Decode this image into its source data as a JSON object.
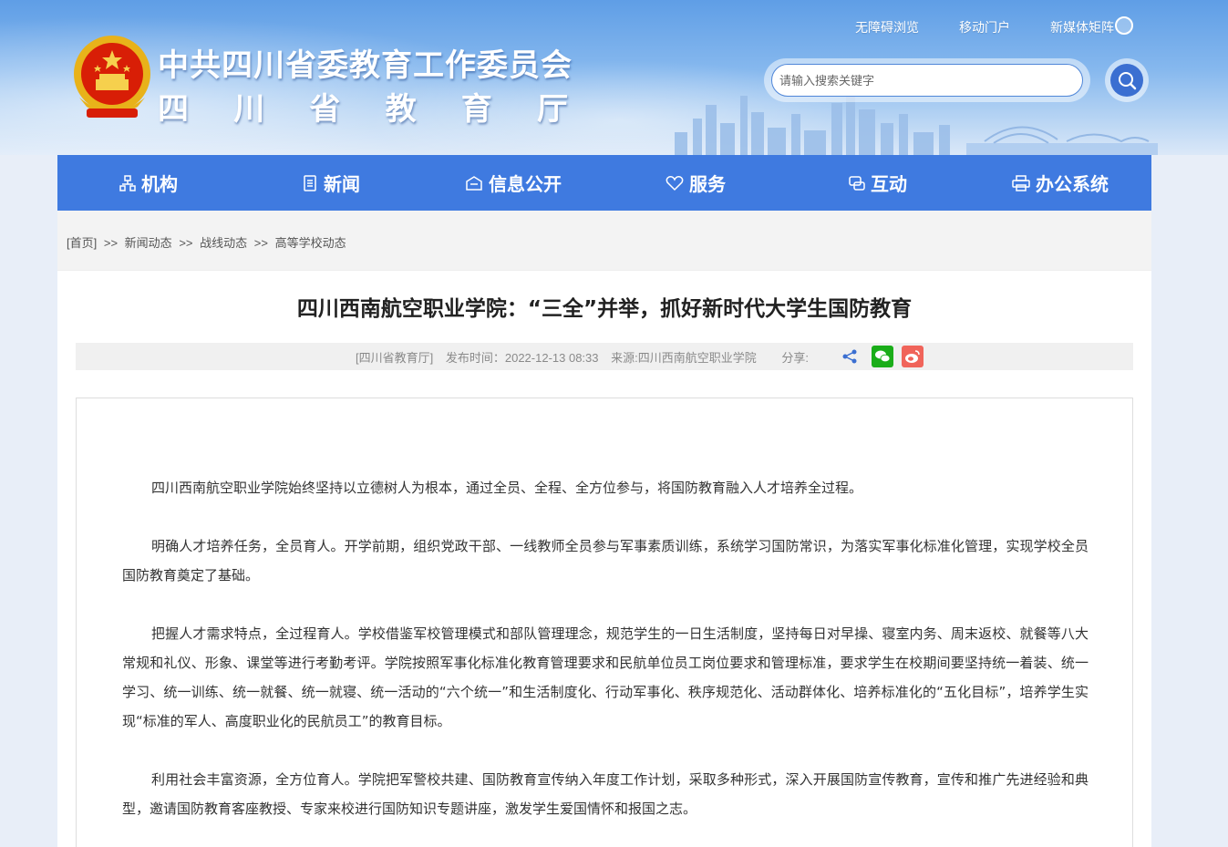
{
  "header": {
    "org_name": "中共四川省委教育工作委员会",
    "dept_chars": [
      "四",
      "川",
      "省",
      "教",
      "育",
      "厅"
    ],
    "top_links": {
      "accessibility": "无障碍浏览",
      "mobile": "移动门户",
      "new_media": "新媒体矩阵"
    },
    "search": {
      "placeholder": "请输入搜索关键字"
    }
  },
  "nav": {
    "items": [
      {
        "label": "机构",
        "icon": "org-icon"
      },
      {
        "label": "新闻",
        "icon": "news-icon"
      },
      {
        "label": "信息公开",
        "icon": "info-icon"
      },
      {
        "label": "服务",
        "icon": "service-icon"
      },
      {
        "label": "互动",
        "icon": "interact-icon"
      },
      {
        "label": "办公系统",
        "icon": "office-icon"
      }
    ]
  },
  "breadcrumb": {
    "home": "[首页]",
    "separator": ">>",
    "items": [
      "新闻动态",
      "战线动态",
      "高等学校动态"
    ]
  },
  "article": {
    "title": "四川西南航空职业学院：“三全”并举，抓好新时代大学生国防教育",
    "source_tag": "[四川省教育厅]",
    "publish_time": "发布时间：2022-12-13 08:33",
    "origin": "来源:四川西南航空职业学院",
    "share_label": "分享:",
    "paragraphs": [
      "四川西南航空职业学院始终坚持以立德树人为根本，通过全员、全程、全方位参与，将国防教育融入人才培养全过程。",
      "明确人才培养任务，全员育人。开学前期，组织党政干部、一线教师全员参与军事素质训练，系统学习国防常识，为落实军事化标准化管理，实现学校全员国防教育奠定了基础。",
      "把握人才需求特点，全过程育人。学校借鉴军校管理模式和部队管理理念，规范学生的一日生活制度，坚持每日对早操、寝室内务、周末返校、就餐等八大常规和礼仪、形象、课堂等进行考勤考评。学院按照军事化标准化教育管理要求和民航单位员工岗位要求和管理标准，要求学生在校期间要坚持统一着装、统一学习、统一训练、统一就餐、统一就寝、统一活动的“六个统一”和生活制度化、行动军事化、秩序规范化、活动群体化、培养标准化的“五化目标”，培养学生实现“标准的军人、高度职业化的民航员工”的教育目标。",
      "利用社会丰富资源，全方位育人。学院把军警校共建、国防教育宣传纳入年度工作计划，采取多种形式，深入开展国防宣传教育，宣传和推广先进经验和典型，邀请国防教育客座教授、专家来校进行国防知识专题讲座，激发学生爱国情怀和报国之志。"
    ]
  },
  "colors": {
    "nav_bg": "#3f7ae0",
    "search_btn": "#3b6fd1",
    "wechat": "#1aad19",
    "weibo": "#f0645a"
  }
}
